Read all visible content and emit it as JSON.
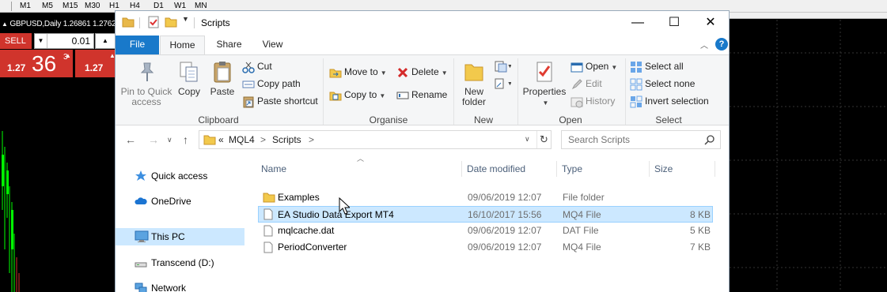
{
  "mt4": {
    "timeframes": [
      "M1",
      "M5",
      "M15",
      "M30",
      "H1",
      "H4",
      "D1",
      "W1",
      "MN"
    ],
    "chart_title": "GBPUSD,Daily  1.26861 1.2762",
    "sell_label": "SELL",
    "lot_size": "0.01",
    "sell_price_prefix": "1.27",
    "sell_price_big": "36",
    "sell_price_sup": "3",
    "buy_price_prefix": "1.27",
    "colors": {
      "sell": "#d0342c",
      "candle": "#00ff00"
    }
  },
  "window": {
    "title": "Scripts",
    "controls": {
      "minimize": "—",
      "maximize": "☐",
      "close": "✕"
    }
  },
  "ribbon": {
    "tabs": [
      {
        "label": "File"
      },
      {
        "label": "Home"
      },
      {
        "label": "Share"
      },
      {
        "label": "View"
      }
    ],
    "clipboard": {
      "group_label": "Clipboard",
      "pin_label": "Pin to Quick access",
      "copy_label": "Copy",
      "paste_label": "Paste",
      "cut_label": "Cut",
      "copy_path_label": "Copy path",
      "paste_shortcut_label": "Paste shortcut"
    },
    "organise": {
      "group_label": "Organise",
      "move_to_label": "Move to",
      "copy_to_label": "Copy to",
      "delete_label": "Delete",
      "rename_label": "Rename"
    },
    "new": {
      "group_label": "New",
      "new_folder_label": "New folder"
    },
    "open": {
      "group_label": "Open",
      "properties_label": "Properties",
      "open_label": "Open",
      "edit_label": "Edit",
      "history_label": "History"
    },
    "select": {
      "group_label": "Select",
      "select_all_label": "Select all",
      "select_none_label": "Select none",
      "invert_label": "Invert selection"
    }
  },
  "address": {
    "overflow": "«",
    "crumbs": [
      "MQL4",
      "Scripts"
    ],
    "separator": ">",
    "search_placeholder": "Search Scripts"
  },
  "nav_pane": {
    "items": [
      {
        "label": "Quick access",
        "icon": "star-icon"
      },
      {
        "label": "OneDrive",
        "icon": "cloud-icon"
      },
      {
        "label": "This PC",
        "icon": "computer-icon",
        "selected": true
      },
      {
        "label": "Transcend (D:)",
        "icon": "drive-icon"
      },
      {
        "label": "Network",
        "icon": "network-icon"
      }
    ]
  },
  "files": {
    "columns": [
      "Name",
      "Date modified",
      "Type",
      "Size"
    ],
    "rows": [
      {
        "name": "Examples",
        "date": "09/06/2019 12:07",
        "type": "File folder",
        "size": "",
        "icon": "folder-icon"
      },
      {
        "name": "EA Studio Data Export MT4",
        "date": "16/10/2017 15:56",
        "type": "MQ4 File",
        "size": "8 KB",
        "icon": "file-icon",
        "selected": true
      },
      {
        "name": "mqlcache.dat",
        "date": "09/06/2019 12:07",
        "type": "DAT File",
        "size": "5 KB",
        "icon": "file-icon"
      },
      {
        "name": "PeriodConverter",
        "date": "09/06/2019 12:07",
        "type": "MQ4 File",
        "size": "7 KB",
        "icon": "file-icon"
      }
    ]
  }
}
